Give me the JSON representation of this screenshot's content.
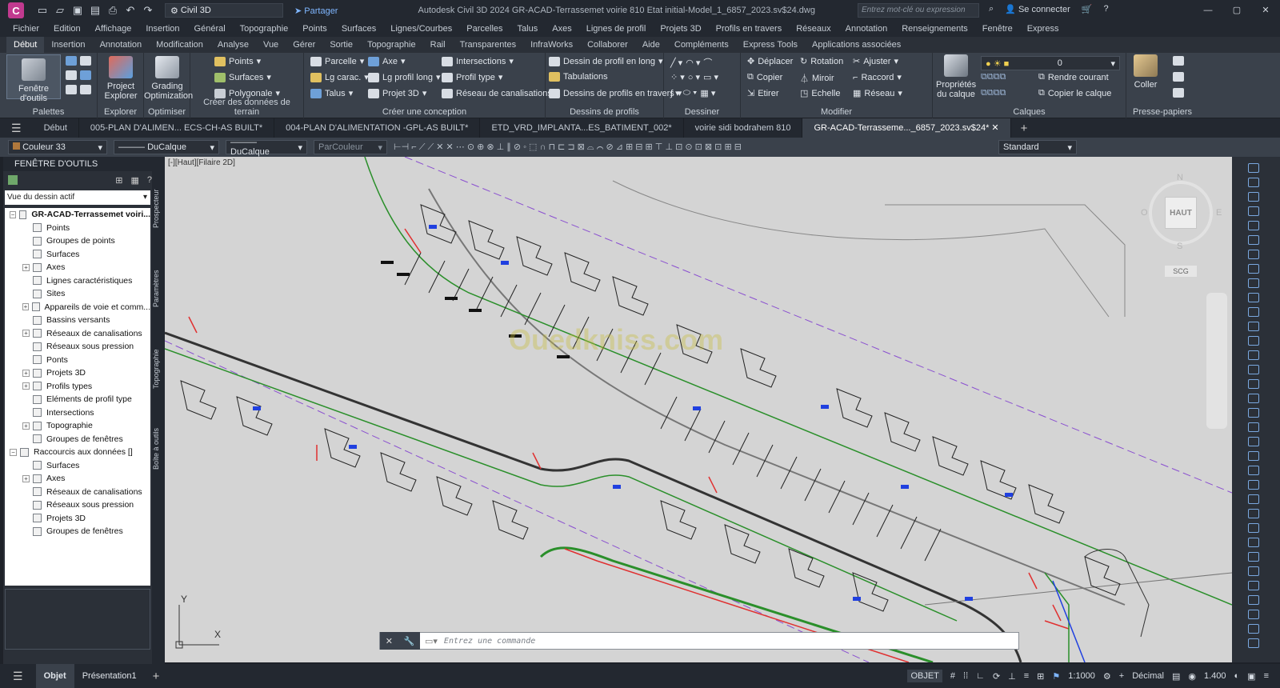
{
  "app": {
    "logo": "C",
    "workspace": "Civil 3D",
    "share": "Partager",
    "title": "Autodesk Civil 3D 2024   GR-ACAD-Terrassemet voirie 810 Etat initial-Model_1_6857_2023.sv$24.dwg",
    "search_placeholder": "Entrez mot-clé ou expression",
    "signin": "Se connecter"
  },
  "menu": [
    "Fichier",
    "Edition",
    "Affichage",
    "Insertion",
    "Général",
    "Topographie",
    "Points",
    "Surfaces",
    "Lignes/Courbes",
    "Parcelles",
    "Talus",
    "Axes",
    "Lignes de profil",
    "Projets 3D",
    "Profils en travers",
    "Réseaux",
    "Annotation",
    "Renseignements",
    "Fenêtre",
    "Express"
  ],
  "ribbon_tabs": [
    "Début",
    "Insertion",
    "Annotation",
    "Modification",
    "Analyse",
    "Vue",
    "Gérer",
    "Sortie",
    "Topographie",
    "Rail",
    "Transparentes",
    "InfraWorks",
    "Collaborer",
    "Aide",
    "Compléments",
    "Express Tools",
    "Applications associées"
  ],
  "ribbon": {
    "palettes": {
      "title": "Palettes",
      "btn": "Fenêtre d'outils"
    },
    "explorer": {
      "title": "Explorer",
      "btn1": "Project",
      "btn2": "Explorer"
    },
    "optimiser": {
      "title": "Optimiser",
      "btn1": "Grading",
      "btn2": "Optimization"
    },
    "creer_terrain": {
      "title": "Créer des données de terrain",
      "items": [
        "Points",
        "Surfaces",
        "Polygonale"
      ]
    },
    "creer_conception": {
      "title": "Créer une conception",
      "items": [
        "Parcelle",
        "Axe",
        "Intersections",
        "Lg carac.",
        "Lg profil long",
        "Profil type",
        "Talus",
        "Projet 3D",
        "Réseau de canalisations"
      ]
    },
    "dessins_profils": {
      "title": "Dessins de profils",
      "items": [
        "Dessin de profil en long",
        "Tabulations",
        "Dessins de profils en travers"
      ]
    },
    "dessiner": {
      "title": "Dessiner"
    },
    "modifier": {
      "title": "Modifier",
      "items": [
        "Déplacer",
        "Rotation",
        "Ajuster",
        "Copier",
        "Miroir",
        "Raccord",
        "Etirer",
        "Echelle",
        "Réseau"
      ]
    },
    "calques": {
      "title": "Calques",
      "btn1": "Propriétés",
      "btn2": "du calque",
      "layer": "0",
      "items": [
        "Rendre courant",
        "Copier le calque"
      ]
    },
    "presse": {
      "title": "Presse-papiers",
      "btn": "Coller"
    }
  },
  "doc_tabs": [
    "Début",
    "005-PLAN D'ALIMEN... ECS-CH-AS BUILT*",
    "004-PLAN D'ALIMENTATION -GPL-AS BUILT*",
    "ETD_VRD_IMPLANTA...ES_BATIMENT_002*",
    "voirie sidi bodrahem 810",
    "GR-ACAD-Terrasseme..._6857_2023.sv$24*"
  ],
  "props": {
    "color": "Couleur 33",
    "linetype1": "DuCalque",
    "linetype2": "DuCalque",
    "plot": "ParCouleur",
    "style": "Standard"
  },
  "toolspace": {
    "title": "FENÊTRE D'OUTILS",
    "view_select": "Vue du dessin actif",
    "tree": [
      {
        "label": "GR-ACAD-Terrassemet voiri...",
        "level": 0,
        "bold": true
      },
      {
        "label": "Points",
        "level": 1
      },
      {
        "label": "Groupes de points",
        "level": 1
      },
      {
        "label": "Surfaces",
        "level": 1
      },
      {
        "label": "Axes",
        "level": 1
      },
      {
        "label": "Lignes caractéristiques",
        "level": 1
      },
      {
        "label": "Sites",
        "level": 1
      },
      {
        "label": "Appareils de voie et comm...",
        "level": 1
      },
      {
        "label": "Bassins versants",
        "level": 1
      },
      {
        "label": "Réseaux de canalisations",
        "level": 1
      },
      {
        "label": "Réseaux sous pression",
        "level": 1
      },
      {
        "label": "Ponts",
        "level": 1
      },
      {
        "label": "Projets 3D",
        "level": 1
      },
      {
        "label": "Profils types",
        "level": 1
      },
      {
        "label": "Eléments de profil type",
        "level": 1
      },
      {
        "label": "Intersections",
        "level": 1
      },
      {
        "label": "Topographie",
        "level": 1
      },
      {
        "label": "Groupes de fenêtres",
        "level": 1
      },
      {
        "label": "Raccourcis aux données []",
        "level": 0
      },
      {
        "label": "Surfaces",
        "level": 1
      },
      {
        "label": "Axes",
        "level": 1
      },
      {
        "label": "Réseaux de canalisations",
        "level": 1
      },
      {
        "label": "Réseaux sous pression",
        "level": 1
      },
      {
        "label": "Projets 3D",
        "level": 1
      },
      {
        "label": "Groupes de fenêtres",
        "level": 1
      }
    ],
    "side_tabs": [
      "Prospecteur",
      "Paramètres",
      "Topographie",
      "Boîte à outils"
    ]
  },
  "canvas": {
    "view_label": "[-][Haut][Filaire 2D]",
    "navcube_top": "HAUT",
    "compass": {
      "n": "N",
      "s": "S",
      "e": "E",
      "w": "O"
    },
    "ucs_label": "SCG",
    "watermark": "Ouedkniss.com",
    "command_placeholder": "Entrez une commande",
    "axis_x": "X",
    "axis_y": "Y"
  },
  "status": {
    "tabs": [
      "Objet",
      "Présentation1"
    ],
    "model": "OBJET",
    "scale": "1:1000",
    "units": "Décimal",
    "value": "1.400"
  },
  "colors": {
    "accent": "#c13a8f",
    "ribbon": "#3a414b",
    "canvas": "#d4d4d4"
  }
}
